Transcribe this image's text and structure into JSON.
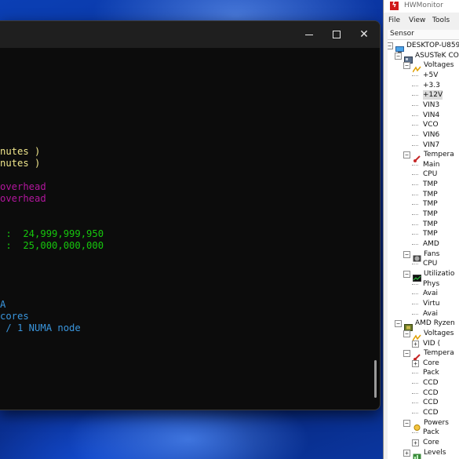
{
  "terminal": {
    "lines": [
      {
        "text": "nutes )",
        "color": "yellow"
      },
      {
        "text": "nutes )",
        "color": "yellow"
      },
      {
        "text": "overhead",
        "color": "magenta"
      },
      {
        "text": "overhead",
        "color": "magenta"
      },
      {
        "text": " :  24,999,999,950",
        "color": "green"
      },
      {
        "text": " :  25,000,000,000",
        "color": "green"
      },
      {
        "text": "A",
        "color": "blue"
      },
      {
        "text": "cores",
        "color": "blue"
      },
      {
        "text": " / 1 NUMA node",
        "color": "blue"
      }
    ]
  },
  "hwmonitor": {
    "title": "HWMonitor",
    "menu": [
      "File",
      "View",
      "Tools"
    ],
    "column_header": "Sensor",
    "tree": [
      {
        "label": "DESKTOP-U859",
        "icon": "computer-icon",
        "exp": "-"
      },
      {
        "label": "ASUSTeK CO",
        "icon": "motherboard-icon",
        "exp": "-"
      },
      {
        "label": "Voltages",
        "icon": "voltage-icon",
        "exp": "-"
      },
      {
        "label": "+5V",
        "icon": "",
        "exp": ""
      },
      {
        "label": "+3.3",
        "icon": "",
        "exp": ""
      },
      {
        "label": "+12V",
        "icon": "",
        "exp": "",
        "selected": true
      },
      {
        "label": "VIN3",
        "icon": "",
        "exp": ""
      },
      {
        "label": "VIN4",
        "icon": "",
        "exp": ""
      },
      {
        "label": "VCO",
        "icon": "",
        "exp": ""
      },
      {
        "label": "VIN6",
        "icon": "",
        "exp": ""
      },
      {
        "label": "VIN7",
        "icon": "",
        "exp": ""
      },
      {
        "label": "Tempera",
        "icon": "thermometer-icon",
        "exp": "-"
      },
      {
        "label": "Main",
        "icon": "",
        "exp": ""
      },
      {
        "label": "CPU",
        "icon": "",
        "exp": ""
      },
      {
        "label": "TMP",
        "icon": "",
        "exp": ""
      },
      {
        "label": "TMP",
        "icon": "",
        "exp": ""
      },
      {
        "label": "TMP",
        "icon": "",
        "exp": ""
      },
      {
        "label": "TMP",
        "icon": "",
        "exp": ""
      },
      {
        "label": "TMP",
        "icon": "",
        "exp": ""
      },
      {
        "label": "TMP",
        "icon": "",
        "exp": ""
      },
      {
        "label": "AMD",
        "icon": "",
        "exp": ""
      },
      {
        "label": "Fans",
        "icon": "fan-icon",
        "exp": "-"
      },
      {
        "label": "CPU",
        "icon": "",
        "exp": ""
      },
      {
        "label": "Utilizatio",
        "icon": "utilization-icon",
        "exp": "-"
      },
      {
        "label": "Phys",
        "icon": "",
        "exp": ""
      },
      {
        "label": "Avai",
        "icon": "",
        "exp": ""
      },
      {
        "label": "Virtu",
        "icon": "",
        "exp": ""
      },
      {
        "label": "Avai",
        "icon": "",
        "exp": ""
      },
      {
        "label": "AMD Ryzen",
        "icon": "cpu-chip-icon",
        "exp": "-"
      },
      {
        "label": "Voltages",
        "icon": "voltage-icon",
        "exp": "-"
      },
      {
        "label": "VID (",
        "icon": "",
        "exp": "+"
      },
      {
        "label": "Tempera",
        "icon": "thermometer-icon",
        "exp": "-"
      },
      {
        "label": "Core",
        "icon": "",
        "exp": "+"
      },
      {
        "label": "Pack",
        "icon": "",
        "exp": ""
      },
      {
        "label": "CCD",
        "icon": "",
        "exp": ""
      },
      {
        "label": "CCD",
        "icon": "",
        "exp": ""
      },
      {
        "label": "CCD",
        "icon": "",
        "exp": ""
      },
      {
        "label": "CCD",
        "icon": "",
        "exp": ""
      },
      {
        "label": "Powers",
        "icon": "power-icon",
        "exp": "-"
      },
      {
        "label": "Pack",
        "icon": "",
        "exp": ""
      },
      {
        "label": "Core",
        "icon": "",
        "exp": "+"
      },
      {
        "label": "Levels",
        "icon": "levels-icon",
        "exp": "+"
      }
    ]
  }
}
